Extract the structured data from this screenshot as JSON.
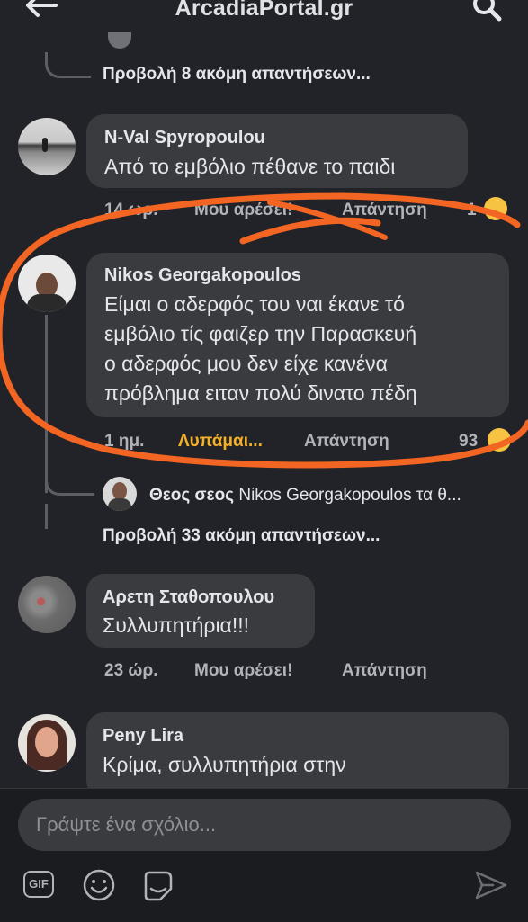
{
  "header": {
    "title": "ArcadiaPortal.gr"
  },
  "thread_top": {
    "more_replies": "Προβολή 8 ακόμη απαντήσεων..."
  },
  "comments": [
    {
      "name": "N-Val Spyropoulou",
      "text": "Από το εμβόλιο πέθανε το παιδι",
      "time": "14 ωρ.",
      "like": "Μου αρέσει!",
      "reply": "Απάντηση",
      "reactions": "1"
    },
    {
      "name": "Nikos Georgakopoulos",
      "lines": [
        "Είμαι ο αδερφός του ναι έκανε τό",
        "εμβόλιο τίς φαιζερ την Παρασκευή",
        "ο αδερφός μου δεν είχε κανένα",
        "πρόβλημα ειταν πολύ δινατο πέδη"
      ],
      "time": "1 ημ.",
      "like": "Λυπάμαι...",
      "reply": "Απάντηση",
      "reactions": "93",
      "sub_reply": {
        "author": "Θεος σεος",
        "text": "Nikos Georgakopoulos τα θ..."
      },
      "more_replies": "Προβολή 33 ακόμη απαντήσεων..."
    },
    {
      "name": "Αρετη Σταθοπουλου",
      "text": "Συλλυπητήρια!!!",
      "time": "23 ώρ.",
      "like": "Μου αρέσει!",
      "reply": "Απάντηση"
    },
    {
      "name": "Peny Lira",
      "text": "Κρίμα, συλλυπητήρια στην"
    }
  ],
  "composer": {
    "placeholder": "Γράψτε ένα σχόλιο..."
  },
  "toolbar": {
    "gif_label": "GIF"
  },
  "colors": {
    "annotation": "#f26522",
    "background": "#222328",
    "bubble": "#3a3b3f",
    "reaction_active": "#f7b125"
  }
}
